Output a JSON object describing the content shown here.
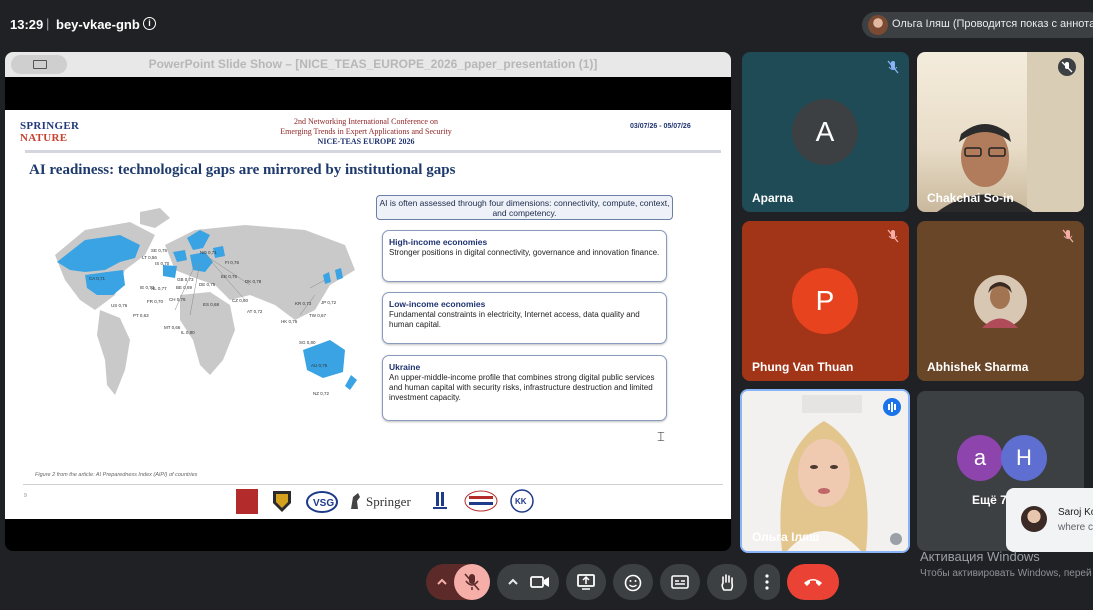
{
  "topbar": {
    "time": "13:29",
    "separator": "|",
    "meeting_code": "bey-vkae-gnb",
    "presenter_status": "Ольга Іляш (Проводится показ с аннотац"
  },
  "presentation": {
    "window_title": "PowerPoint Slide Show – [NICE_TEAS_EUROPE_2026_paper_presentation (1)]",
    "slide": {
      "logo_line1": "SPRINGER",
      "logo_line2": "NATURE",
      "conference_line1": "2nd Networking International Conference on",
      "conference_line2": "Emerging Trends in Expert Applications and Security",
      "conference_line3": "NICE-TEAS EUROPE 2026",
      "dates": "03/07/26 - 05/07/26",
      "title": "AI readiness: technological gaps are mirrored by institutional gaps",
      "intro": "AI is often assessed through four dimensions: connectivity, compute, context, and competency.",
      "boxes": [
        {
          "heading": "High-income economies",
          "body": "Stronger positions in digital connectivity, governance and innovation finance."
        },
        {
          "heading": "Low-income economies",
          "body": "Fundamental constraints in electricity, Internet access, data quality and human capital."
        },
        {
          "heading": "Ukraine",
          "body": "An upper-middle-income profile that combines strong digital public services and human capital with security risks, infrastructure destruction and limited investment capacity."
        }
      ],
      "caption": "Figure 2 from the article: AI Preparedness Index (AIPI) of countries",
      "page_number": "9",
      "footer_brand": "Springer",
      "map_labels": [
        "SE 0,75",
        "NO 0,71",
        "FI 0,76",
        "LT 0,56",
        "IS 0,70",
        "EE 0,76",
        "DK 0,78",
        "CA 0,71",
        "IE 0,73",
        "NL 0,77",
        "BE 0,69",
        "GB 0,73",
        "DE 0,75",
        "CZ 0,60",
        "AT 0,72",
        "ES 0,68",
        "FR 0,70",
        "CH 0,76",
        "US 0,76",
        "PT 0,63",
        "MT 0,66",
        "IL 0,80",
        "HK 0,75",
        "KR 0,73",
        "JP 0,72",
        "TW 0,67",
        "SG 0,80",
        "AU 0,75",
        "NZ 0,72"
      ]
    }
  },
  "participants": [
    {
      "name": "Aparna",
      "initial": "A",
      "muted": true,
      "avatar_color": "#3c4043",
      "bg": "#1e4b55"
    },
    {
      "name": "Chakchai So-in",
      "muted": true,
      "video": true
    },
    {
      "name": "Phung Van Thuan",
      "initial": "P",
      "muted": true,
      "avatar_color": "#e8431f",
      "bg": "#a23417"
    },
    {
      "name": "Abhishek Sharma",
      "muted": true,
      "bg": "#6a4628"
    },
    {
      "name": "Ольга Іляш",
      "speaking": true,
      "video": true
    },
    {
      "name": "Ещё 7",
      "initials": [
        "a",
        "H"
      ]
    }
  ],
  "toast": {
    "name": "Saroj Ko",
    "message": "where c"
  },
  "activation": {
    "title": "Активация Windows",
    "subtitle": "Чтобы активировать Windows, перей"
  },
  "controls": [
    "mic-options",
    "microphone-muted",
    "camera-options",
    "camera",
    "present-screen",
    "emoji-reactions",
    "captions",
    "raise-hand",
    "more-options",
    "leave-call"
  ],
  "colors": {
    "background": "#202124",
    "tile": "#3c4043",
    "hangup": "#ea4335",
    "muted_mic": "#f6aea9",
    "accent_blue": "#8ab4f8"
  }
}
